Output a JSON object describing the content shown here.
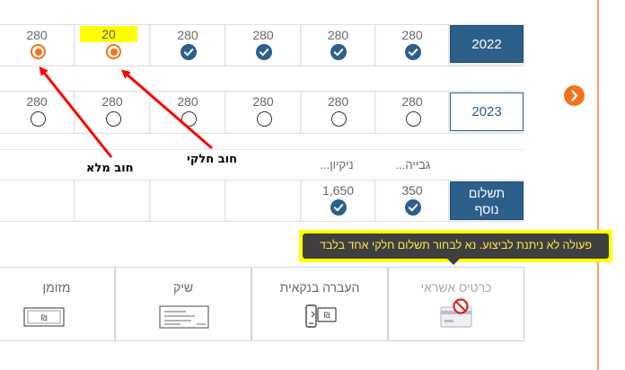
{
  "rows": [
    {
      "year": "2022",
      "year_style": "selected",
      "cells": [
        {
          "value": "280",
          "state": "selected"
        },
        {
          "value": "20",
          "state": "selected",
          "highlight": true
        },
        {
          "value": "280",
          "state": "checked"
        },
        {
          "value": "280",
          "state": "checked"
        },
        {
          "value": "280",
          "state": "checked"
        },
        {
          "value": "280",
          "state": "checked"
        }
      ]
    },
    {
      "year": "2023",
      "year_style": "outline",
      "cells": [
        {
          "value": "280",
          "state": "empty"
        },
        {
          "value": "280",
          "state": "empty"
        },
        {
          "value": "280",
          "state": "empty"
        },
        {
          "value": "280",
          "state": "empty"
        },
        {
          "value": "280",
          "state": "empty"
        },
        {
          "value": "280",
          "state": "empty"
        }
      ]
    }
  ],
  "extra": {
    "headers": [
      "...ניקיון",
      "...גבייה"
    ],
    "label": "תשלום נוסף",
    "label_line1": "תשלום",
    "label_line2": "נוסף",
    "cells": [
      {
        "value": "",
        "state": "none"
      },
      {
        "value": "",
        "state": "none"
      },
      {
        "value": "",
        "state": "none"
      },
      {
        "value": "",
        "state": "none"
      },
      {
        "value": "1,650",
        "state": "checked"
      },
      {
        "value": "350",
        "state": "checked"
      }
    ]
  },
  "annotations": {
    "full_debt": "חוב מלא",
    "partial_debt": "חוב חלקי"
  },
  "tooltip": "פעולה לא ניתנת לביצוע. נא לבחור תשלום חלקי אחד בלבד",
  "payment_methods": [
    {
      "label": "כרטיס אשראי",
      "icon": "credit-card-blocked-icon",
      "disabled": true
    },
    {
      "label": "העברה בנקאית",
      "icon": "bank-transfer-icon",
      "disabled": false
    },
    {
      "label": "שיק",
      "icon": "check-icon",
      "disabled": false
    },
    {
      "label": "מזומן",
      "icon": "cash-icon",
      "disabled": false
    }
  ],
  "currency_symbol": "₪",
  "colors": {
    "brand_blue": "#2d5f8b",
    "accent_orange": "#f4721b",
    "tooltip_bg": "#3f3f3f",
    "tooltip_text": "#ffe84a",
    "highlight_yellow": "#ffff00",
    "annotation_red": "#ff0000"
  }
}
